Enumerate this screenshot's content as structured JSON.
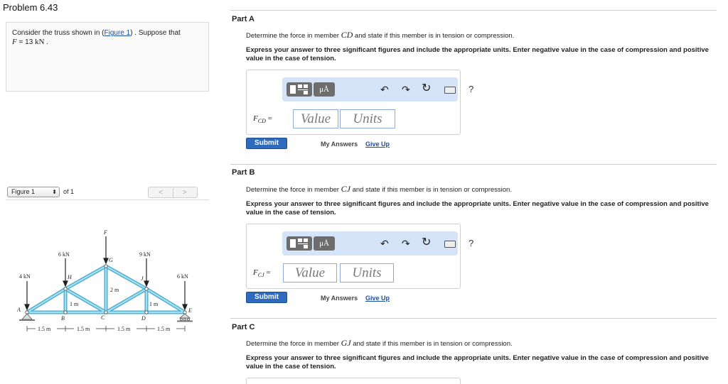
{
  "problem": {
    "title": "Problem 6.43",
    "statement_prefix": "Consider the truss shown in (",
    "figure_link": "Figure 1",
    "statement_suffix": ") . Suppose that",
    "given_var": "F",
    "given_eq": " = 13 ",
    "given_unit": "kN",
    "given_end": " ."
  },
  "figure_bar": {
    "select_label": "Figure 1",
    "select_arrows": "⬍",
    "of_text": "of 1",
    "prev_label": "<",
    "next_label": ">"
  },
  "figure": {
    "labels": {
      "F": "F",
      "G": "G",
      "H": "H",
      "J": "J",
      "A": "A",
      "B": "B",
      "C": "C",
      "D": "D",
      "E": "E",
      "load_A": "4 kN",
      "load_H": "6 kN",
      "load_F": "9 kN",
      "load_J": "6 kN",
      "load_E": "6 kN",
      "dim_2m": "2 m",
      "dim_1m_left": "1 m",
      "dim_1m_right": "1 m",
      "span1": "1.5 m",
      "span2": "1.5 m",
      "span3": "1.5 m",
      "span4": "1.5 m"
    }
  },
  "toolbar": {
    "templates_icon": "templates-icon",
    "units_button": "μÅ",
    "undo": "↶",
    "redo": "↷",
    "reset": "↻",
    "keyboard_icon": "keyboard-icon",
    "help": "?"
  },
  "parts": [
    {
      "label": "Part A",
      "question_prefix": "Determine the force in member ",
      "member": "CD",
      "question_suffix": " and state if this member is in tension or compression.",
      "instruction": "Express your answer to three significant figures and include the appropriate units. Enter negative value in the case of compression and positive value in the case of tension.",
      "var_main": "F",
      "var_sub": "CD",
      "equals": " =",
      "value_placeholder": "Value",
      "units_placeholder": "Units",
      "submit": "Submit",
      "my_answers": "My Answers",
      "give_up": "Give Up"
    },
    {
      "label": "Part B",
      "question_prefix": "Determine the force in member ",
      "member": "CJ",
      "question_suffix": " and state if this member is in tension or compression.",
      "instruction": "Express your answer to three significant figures and include the appropriate units. Enter negative value in the case of compression and positive value in the case of tension.",
      "var_main": "F",
      "var_sub": "CJ",
      "equals": " =",
      "value_placeholder": "Value",
      "units_placeholder": "Units",
      "submit": "Submit",
      "my_answers": "My Answers",
      "give_up": "Give Up"
    },
    {
      "label": "Part C",
      "question_prefix": "Determine the force in member ",
      "member": "GJ",
      "question_suffix": " and state if this member is in tension or compression.",
      "instruction": "Express your answer to three significant figures and include the appropriate units. Enter negative value in the case of compression and positive value in the case of tension."
    }
  ],
  "colors": {
    "truss_member": "#7fd3ec",
    "truss_outline": "#4aa9c9",
    "link": "#1a4fa3",
    "submit": "#2f6bbd",
    "toolbar_bg": "#d4e3f7"
  }
}
